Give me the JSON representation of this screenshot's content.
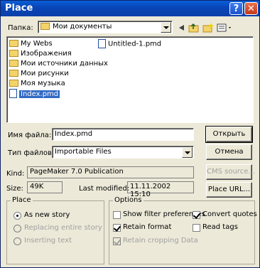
{
  "window": {
    "title": "Place",
    "help_label": "?",
    "close_label": "✕"
  },
  "lookin": {
    "label": "Папка:",
    "value": "Мои документы"
  },
  "files": [
    {
      "name": "My Webs",
      "kind": "folder"
    },
    {
      "name": "Изображения",
      "kind": "folder"
    },
    {
      "name": "Мои источники данных",
      "kind": "folder"
    },
    {
      "name": "Мои рисунки",
      "kind": "folder"
    },
    {
      "name": "Моя музыка",
      "kind": "folder"
    },
    {
      "name": "Index.pmd",
      "kind": "file",
      "selected": true
    },
    {
      "name": "Untitled-1.pmd",
      "kind": "file"
    }
  ],
  "filename": {
    "label": "Имя файла:",
    "value": "Index.pmd"
  },
  "filetype": {
    "label": "Тип файлов:",
    "value": "Importable Files"
  },
  "kind": {
    "label": "Kind:",
    "value": "PageMaker 7.0 Publication"
  },
  "size": {
    "label": "Size:",
    "value": "49K"
  },
  "modified": {
    "label": "Last modified:",
    "value": "11.11.2002 15:10"
  },
  "buttons": {
    "open": "Открыть",
    "cancel": "Отмена",
    "cms": "CMS source...",
    "place_url": "Place URL..."
  },
  "place_group": {
    "title": "Place",
    "options": [
      {
        "label": "As new story",
        "checked": true,
        "enabled": true
      },
      {
        "label": "Replacing entire story",
        "checked": false,
        "enabled": false
      },
      {
        "label": "Inserting text",
        "checked": false,
        "enabled": false
      }
    ]
  },
  "options_group": {
    "title": "Options",
    "show_filter": {
      "label": "Show filter preferences",
      "checked": false
    },
    "convert_quotes": {
      "label": "Convert quotes",
      "checked": true
    },
    "retain_format": {
      "label": "Retain format",
      "checked": true
    },
    "read_tags": {
      "label": "Read tags",
      "checked": false
    },
    "retain_cropping": {
      "label": "Retain cropping Data",
      "checked": true,
      "enabled": false
    }
  }
}
